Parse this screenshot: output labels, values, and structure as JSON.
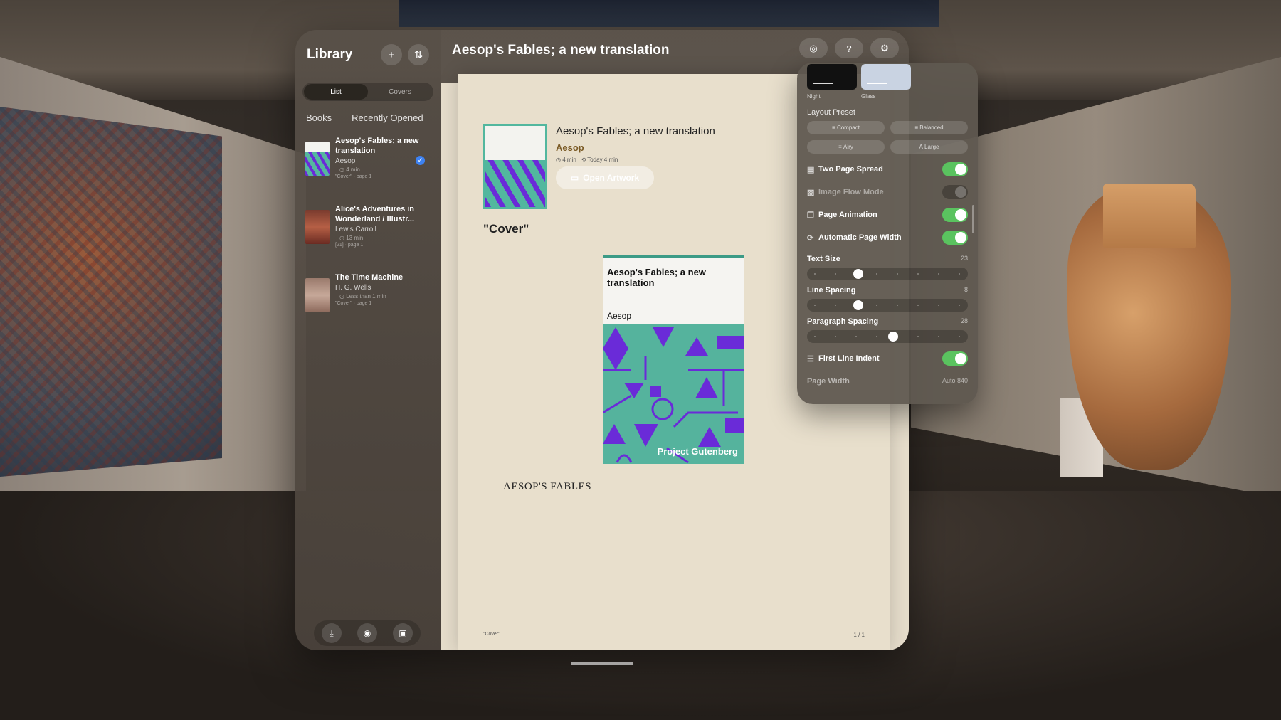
{
  "sidebar": {
    "title": "Library",
    "add_icon": "plus-icon",
    "sort_icon": "sort-arrows-icon",
    "view_modes": [
      "List",
      "Covers"
    ],
    "active_view": "List",
    "tabs": [
      "Books",
      "Recently Opened"
    ],
    "books": [
      {
        "title": "Aesop's Fables; a new translation",
        "author": "Aesop",
        "time": "4 min",
        "location": "\"Cover\" · page 1",
        "selected": true
      },
      {
        "title": "Alice's Adventures in Wonderland / Illustr...",
        "author": "Lewis Carroll",
        "time": "13 min",
        "location": "[21] · page 1",
        "selected": false
      },
      {
        "title": "The Time Machine",
        "author": "H. G. Wells",
        "time": "Less than 1 min",
        "location": "\"Cover\" · page 1",
        "selected": false
      }
    ],
    "bottom_icons": [
      "download-icon",
      "reader-icon",
      "gallery-icon"
    ]
  },
  "reader": {
    "title": "Aesop's Fables; a new translation",
    "header_icons": [
      "eye-icon",
      "help-icon",
      "gear-icon"
    ],
    "meta": {
      "title": "Aesop's Fables; a new translation",
      "author": "Aesop",
      "duration": "4 min",
      "opened": "Today 4 min",
      "open_button": "Open Artwork"
    },
    "chapter_heading": "\"Cover\"",
    "cover": {
      "title": "Aesop's Fables; a new translation",
      "author": "Aesop",
      "publisher": "Project Gutenberg",
      "colors": {
        "background": "#55b39d",
        "shapes": "#6a2bd8"
      }
    },
    "body_heading": "AESOP'S FABLES",
    "footer_left": "\"Cover\"",
    "footer_right": "1 / 1"
  },
  "settings": {
    "themes": [
      {
        "label": "Night"
      },
      {
        "label": "Glass"
      }
    ],
    "layout_preset_title": "Layout Preset",
    "presets": [
      "Compact",
      "Balanced",
      "Airy",
      "Large"
    ],
    "toggles": [
      {
        "label": "Two Page Spread",
        "on": true,
        "enabled": true
      },
      {
        "label": "Image Flow Mode",
        "on": false,
        "enabled": false
      },
      {
        "label": "Page Animation",
        "on": true,
        "enabled": true
      },
      {
        "label": "Automatic Page Width",
        "on": true,
        "enabled": true
      }
    ],
    "sliders": [
      {
        "label": "Text Size",
        "value": "23",
        "fraction": 0.3
      },
      {
        "label": "Line Spacing",
        "value": "8",
        "fraction": 0.3
      },
      {
        "label": "Paragraph Spacing",
        "value": "28",
        "fraction": 0.54
      }
    ],
    "first_line_indent": {
      "label": "First Line Indent",
      "on": true
    },
    "page_width": {
      "label": "Page Width",
      "value": "Auto 840"
    },
    "accent_color": "#5ac35f"
  }
}
